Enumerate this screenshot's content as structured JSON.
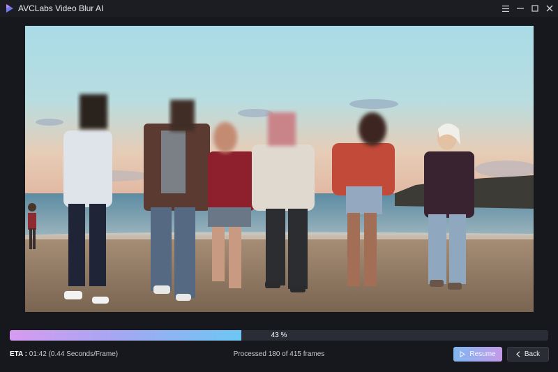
{
  "window": {
    "title": "AVCLabs Video Blur AI"
  },
  "progress": {
    "percent_label": "43 %",
    "fraction": 0.43
  },
  "status": {
    "eta_label": "ETA :",
    "eta_value": "01:42 (0.44 Seconds/Frame)",
    "processed": "Processed 180 of 415 frames"
  },
  "buttons": {
    "resume_label": "Resume",
    "back_label": "Back"
  },
  "colors": {
    "accent_gradient_start": "#d79bf0",
    "accent_gradient_end": "#6cc7f4",
    "background": "#16181d"
  },
  "icons": {
    "logo": "avclabs-logo-icon",
    "menu": "hamburger-menu-icon",
    "minimize": "minimize-icon",
    "maximize": "maximize-icon",
    "close": "close-icon",
    "resume": "play-outline-icon",
    "back": "chevron-left-icon"
  }
}
